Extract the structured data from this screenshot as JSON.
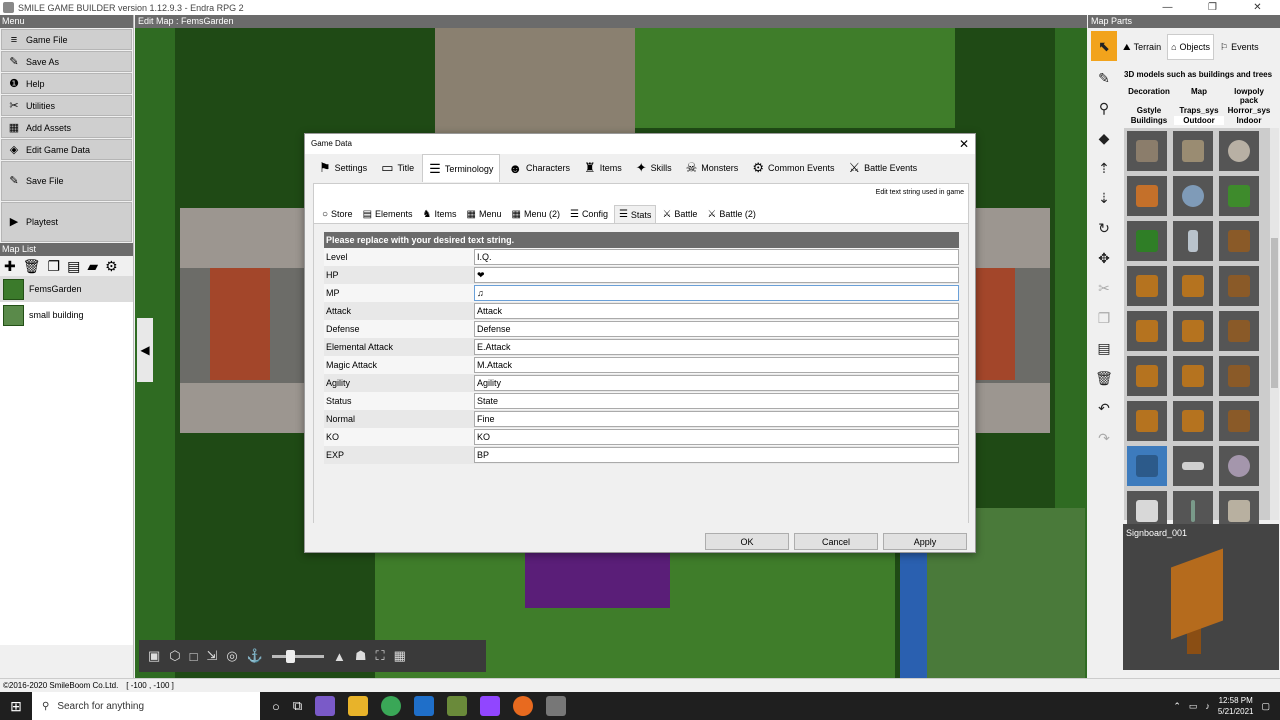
{
  "window": {
    "title": "SMILE GAME BUILDER version 1.12.9.3 - Endra RPG 2",
    "controls": [
      "—",
      "❐",
      "✕"
    ]
  },
  "left_panel": {
    "menu_header": "Menu",
    "menu_items": [
      {
        "label": "Game File",
        "icon": "hamburger-icon",
        "glyph": "≡"
      },
      {
        "label": "Save As",
        "icon": "save-as-icon",
        "glyph": "✎"
      },
      {
        "label": "Help",
        "icon": "help-icon",
        "glyph": "❶"
      },
      {
        "label": "Utilities",
        "icon": "tools-icon",
        "glyph": "✂"
      },
      {
        "label": "Add Assets",
        "icon": "grid-icon",
        "glyph": "▦"
      },
      {
        "label": "Edit Game Data",
        "icon": "game-data-icon",
        "glyph": "◈"
      }
    ],
    "save_file_label": "Save File",
    "playtest_label": "Playtest",
    "map_list_header": "Map List",
    "maps": [
      {
        "name": "FemsGarden",
        "selected": true
      },
      {
        "name": "small building",
        "selected": false
      }
    ]
  },
  "center": {
    "header": "Edit Map : FemsGarden"
  },
  "right_panel": {
    "header": "Map Parts",
    "tabs": [
      {
        "label": "Terrain",
        "icon": "terrain-icon"
      },
      {
        "label": "Objects",
        "icon": "objects-icon"
      },
      {
        "label": "Events",
        "icon": "events-icon"
      }
    ],
    "description": "3D models such as buildings and trees",
    "categories": [
      "Decoration",
      "Map",
      "lowpoly pack",
      "Gstyle",
      "Traps_sys",
      "Horror_sys",
      "Buildings",
      "Outdoor",
      "Indoor"
    ],
    "selected_category": "Outdoor",
    "preview_name": "Signboard_001"
  },
  "statusbar": {
    "copyright": "©2016-2020 SmileBoom Co.Ltd.",
    "coords": "[ -100 , -100 ]"
  },
  "taskbar": {
    "search_placeholder": "Search for anything",
    "time": "12:58 PM",
    "date": "5/21/2021"
  },
  "dialog": {
    "title": "Game Data",
    "tabs": [
      {
        "label": "Settings",
        "icon": "flag-icon",
        "glyph": "⚑"
      },
      {
        "label": "Title",
        "icon": "title-screen-icon",
        "glyph": "▭"
      },
      {
        "label": "Terminology",
        "icon": "terminology-icon",
        "glyph": "☰",
        "active": true
      },
      {
        "label": "Characters",
        "icon": "characters-icon",
        "glyph": "☻"
      },
      {
        "label": "Items",
        "icon": "items-icon",
        "glyph": "♜"
      },
      {
        "label": "Skills",
        "icon": "skills-icon",
        "glyph": "✦"
      },
      {
        "label": "Monsters",
        "icon": "monsters-icon",
        "glyph": "☠"
      },
      {
        "label": "Common Events",
        "icon": "common-events-icon",
        "glyph": "⚙"
      },
      {
        "label": "Battle Events",
        "icon": "battle-events-icon",
        "glyph": "⚔"
      }
    ],
    "hint": "Edit text string used in game",
    "subtabs": [
      {
        "label": "Store",
        "icon": "store-icon",
        "glyph": "○"
      },
      {
        "label": "Elements",
        "icon": "elements-icon",
        "glyph": "▤"
      },
      {
        "label": "Items",
        "icon": "items-sub-icon",
        "glyph": "♞"
      },
      {
        "label": "Menu",
        "icon": "menu-icon",
        "glyph": "▦"
      },
      {
        "label": "Menu (2)",
        "icon": "menu2-icon",
        "glyph": "▦"
      },
      {
        "label": "Config",
        "icon": "config-icon",
        "glyph": "☰"
      },
      {
        "label": "Stats",
        "icon": "stats-icon",
        "glyph": "☰",
        "active": true
      },
      {
        "label": "Battle",
        "icon": "battle-icon",
        "glyph": "⚔"
      },
      {
        "label": "Battle (2)",
        "icon": "battle2-icon",
        "glyph": "⚔"
      }
    ],
    "table_header": "Please replace with your desired text string.",
    "rows": [
      {
        "label": "Level",
        "value": "I.Q."
      },
      {
        "label": "HP",
        "value": "❤"
      },
      {
        "label": "MP",
        "value": "♫"
      },
      {
        "label": "Attack",
        "value": "Attack"
      },
      {
        "label": "Defense",
        "value": "Defense"
      },
      {
        "label": "Elemental Attack",
        "value": "E.Attack"
      },
      {
        "label": "Magic Attack",
        "value": "M.Attack"
      },
      {
        "label": "Agility",
        "value": "Agility"
      },
      {
        "label": "Status",
        "value": "State"
      },
      {
        "label": "Normal",
        "value": "Fine"
      },
      {
        "label": "KO",
        "value": "KO"
      },
      {
        "label": "EXP",
        "value": "BP"
      }
    ],
    "buttons": {
      "ok": "OK",
      "cancel": "Cancel",
      "apply": "Apply"
    }
  }
}
